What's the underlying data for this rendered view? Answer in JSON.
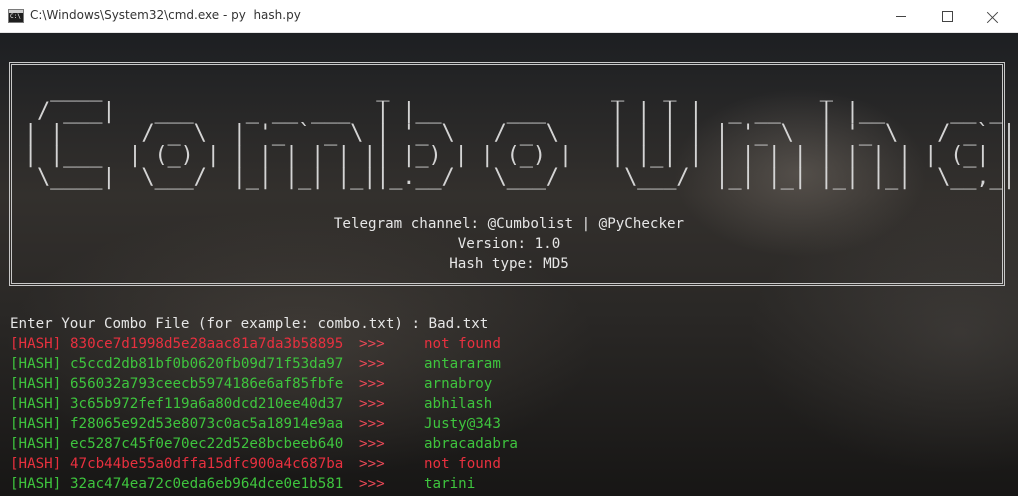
{
  "window": {
    "title": "C:\\Windows\\System32\\cmd.exe - py  hash.py",
    "icon": "cmd-icon"
  },
  "banner": {
    "ascii_art": "  ____                     _                 _   _           _                    _               \n / ___|   ___    _ __ ___  | |__     ___     | | | |  _ __   | |__     __ _   ___  | |__     ___   _ __ \n| |      / _ \\  | '_ ` _ \\ | '_ \\   / _ \\    | | | | | '_ \\  | '_ \\   / _` | / __| | '_ \\   / _ \\ | '__|\n| |___  | (_) | | | | | | || |_) | | (_) |   | |_| | | | | | | | | | | (_| | \\__ \\ | | | | |  __/ | |   \n \\____|  \\___/  |_| |_| |_||_.__/   \\___/     \\___/  |_| |_| |_| |_|  \\__,_| |___/ |_| |_|  \\___| |_|   ",
    "telegram": "Telegram channel: @Cumbolist | @PyChecker",
    "version": "Version: 1.0",
    "hash_type": "Hash type: MD5"
  },
  "prompt": "Enter Your Combo File (for example: combo.txt) : Bad.txt",
  "colors": {
    "found": "#3ec53e",
    "not_found": "#e8303f",
    "arrow": "#e74856",
    "text": "#e6e6e6"
  },
  "results": [
    {
      "tag": "[HASH]",
      "hash": "830ce7d1998d5e28aac81a7da3b58895",
      "arrow": ">>>",
      "result": "not found",
      "status": "bad"
    },
    {
      "tag": "[HASH]",
      "hash": "c5ccd2db81bf0b0620fb09d71f53da97",
      "arrow": ">>>",
      "result": "antararam",
      "status": "ok"
    },
    {
      "tag": "[HASH]",
      "hash": "656032a793ceecb5974186e6af85fbfe",
      "arrow": ">>>",
      "result": "arnabroy",
      "status": "ok"
    },
    {
      "tag": "[HASH]",
      "hash": "3c65b972fef119a6a80dcd210ee40d37",
      "arrow": ">>>",
      "result": "abhilash",
      "status": "ok"
    },
    {
      "tag": "[HASH]",
      "hash": "f28065e92d53e8073c0ac5a18914e9aa",
      "arrow": ">>>",
      "result": "Justy@343",
      "status": "ok"
    },
    {
      "tag": "[HASH]",
      "hash": "ec5287c45f0e70ec22d52e8bcbeeb640",
      "arrow": ">>>",
      "result": "abracadabra",
      "status": "ok"
    },
    {
      "tag": "[HASH]",
      "hash": "47cb44be55a0dffa15dfc900a4c687ba",
      "arrow": ">>>",
      "result": "not found",
      "status": "bad"
    },
    {
      "tag": "[HASH]",
      "hash": "32ac474ea72c0eda6eb964dce0e1b581",
      "arrow": ">>>",
      "result": "tarini",
      "status": "ok"
    }
  ]
}
